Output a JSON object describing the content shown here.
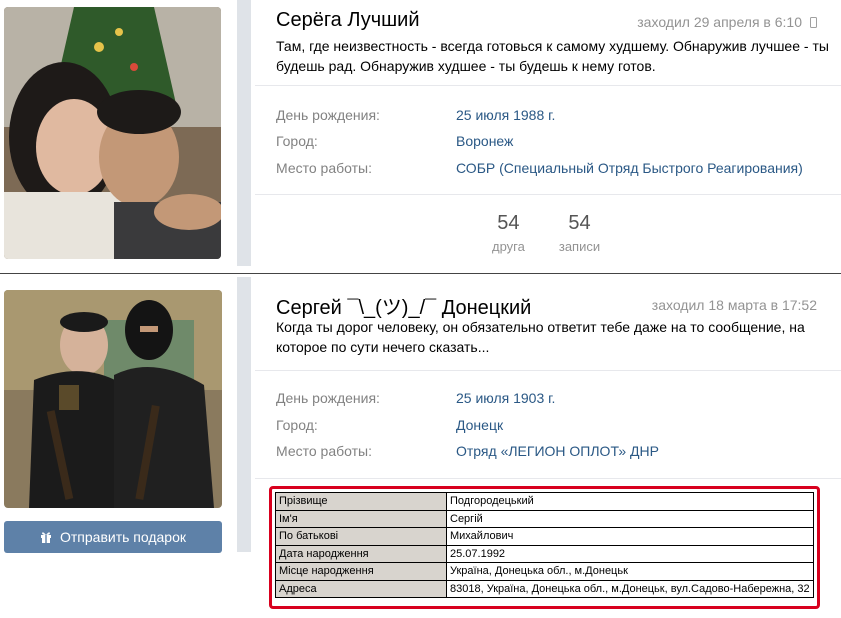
{
  "profiles": [
    {
      "name": "Серёга Лучший",
      "last_seen": "заходил 29 апреля в 6:10",
      "last_seen_icon": "mobile-phone-icon",
      "status": "Там, где неизвестность - всегда готовься к самому худшему. Обнаружив лучшее - ты будешь рад. Обнаружив худшее - ты будешь к нему готов.",
      "fields": [
        {
          "label": "День рождения:",
          "value": "25 июля 1988 г."
        },
        {
          "label": "Город:",
          "value": "Воронеж"
        },
        {
          "label": "Место работы:",
          "value": "СОБР (Специальный Отряд Быстрого Реагирования)"
        }
      ],
      "counters": [
        {
          "num": "54",
          "label": "друга"
        },
        {
          "num": "54",
          "label": "записи"
        }
      ]
    },
    {
      "name": "Сергей ¯\\_(ツ)_/¯ Донецкий",
      "last_seen": "заходил 18 марта в 17:52",
      "status": "Когда ты дорог человеку, он обязательно ответит тебе даже на то сообщение, на которое по сути нечего сказать...",
      "fields": [
        {
          "label": "День рождения:",
          "value": "25 июля 1903 г."
        },
        {
          "label": "Город:",
          "value": "Донецк"
        },
        {
          "label": "Место работы:",
          "value": "Отряд «ЛЕГИОН ОПЛОТ» ДНР"
        }
      ],
      "gift_button": "Отправить подарок",
      "gift_icon": "gift-icon"
    }
  ],
  "registry": [
    {
      "key": "Прізвище",
      "value": "Подгородецький"
    },
    {
      "key": "Ім'я",
      "value": "Сергій"
    },
    {
      "key": "По батькові",
      "value": "Михайлович"
    },
    {
      "key": "Дата народження",
      "value": "25.07.1992"
    },
    {
      "key": "Місце народження",
      "value": "Україна, Донецька обл., м.Донецьк"
    },
    {
      "key": "Адреса",
      "value": "83018, Україна, Донецька обл., м.Донецьк, вул.Садово-Набережна, 32"
    }
  ],
  "colors": {
    "link": "#2a5885",
    "label": "#828282",
    "button": "#5e81a8",
    "highlight_border": "#d8001e"
  }
}
